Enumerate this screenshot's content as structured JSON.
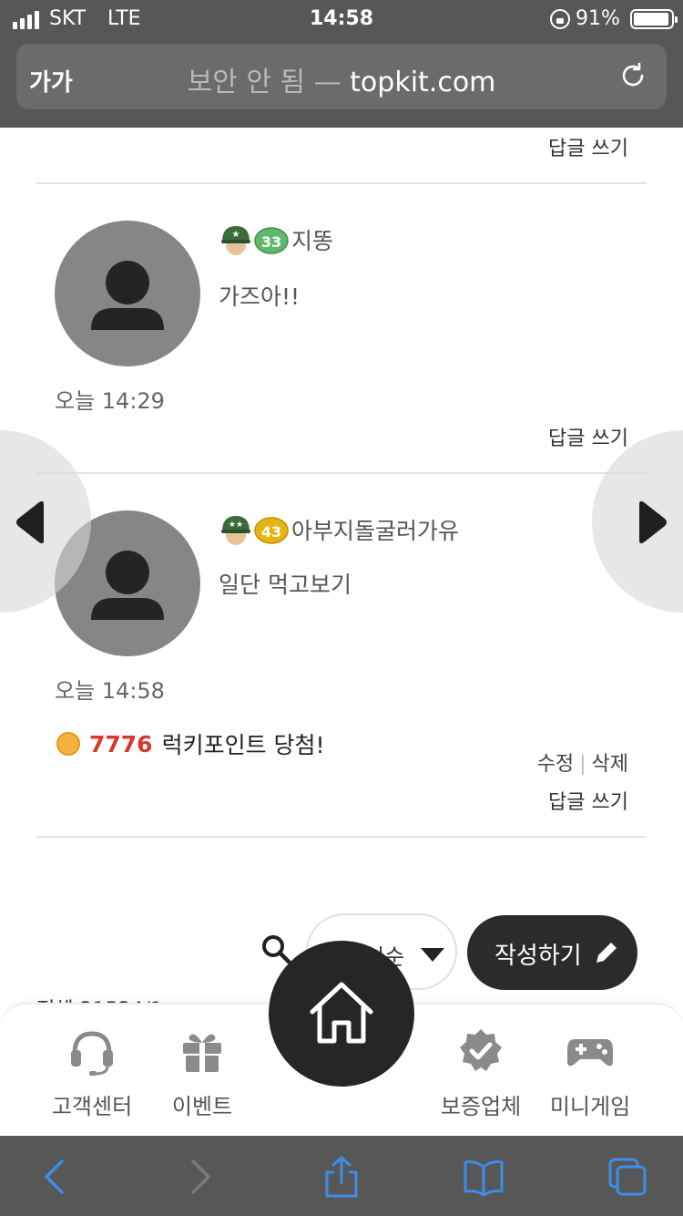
{
  "status_bar": {
    "carrier": "SKT",
    "network": "LTE",
    "time": "14:58",
    "battery_percent": "91%"
  },
  "url_bar": {
    "text_size_label": "가가",
    "security_label": "보안 안 됨 —",
    "domain": "topkit.com"
  },
  "comments": [
    {
      "reply_label": "답글 쓰기"
    },
    {
      "nickname": "지똥",
      "level": "33",
      "level_color": "#5fb96b",
      "text": "가즈아!!",
      "time": "오늘 14:29",
      "reply_label": "답글 쓰기"
    },
    {
      "nickname": "아부지돌굴러가유",
      "level": "43",
      "level_color": "#e7b512",
      "text": "일단 먹고보기",
      "time": "오늘 14:58",
      "reply_label": "답글 쓰기",
      "lucky": {
        "points": "7776",
        "text": "럭키포인트 당첨!"
      },
      "edit_label": "수정",
      "delete_label": "삭제"
    }
  ],
  "toolbar": {
    "sort_label": "최신순",
    "write_label": "작성하기",
    "total_partial": "전체 31534/1"
  },
  "bottom_nav": [
    {
      "label": "고객센터",
      "icon": "headset-icon"
    },
    {
      "label": "이벤트",
      "icon": "gift-icon"
    },
    {
      "label": "보증업체",
      "icon": "verified-badge-icon"
    },
    {
      "label": "미니게임",
      "icon": "gamepad-icon"
    }
  ],
  "colors": {
    "accent_red": "#d9372a",
    "dark_button": "#2b2b2b",
    "safari_blue": "#3b8de8"
  }
}
